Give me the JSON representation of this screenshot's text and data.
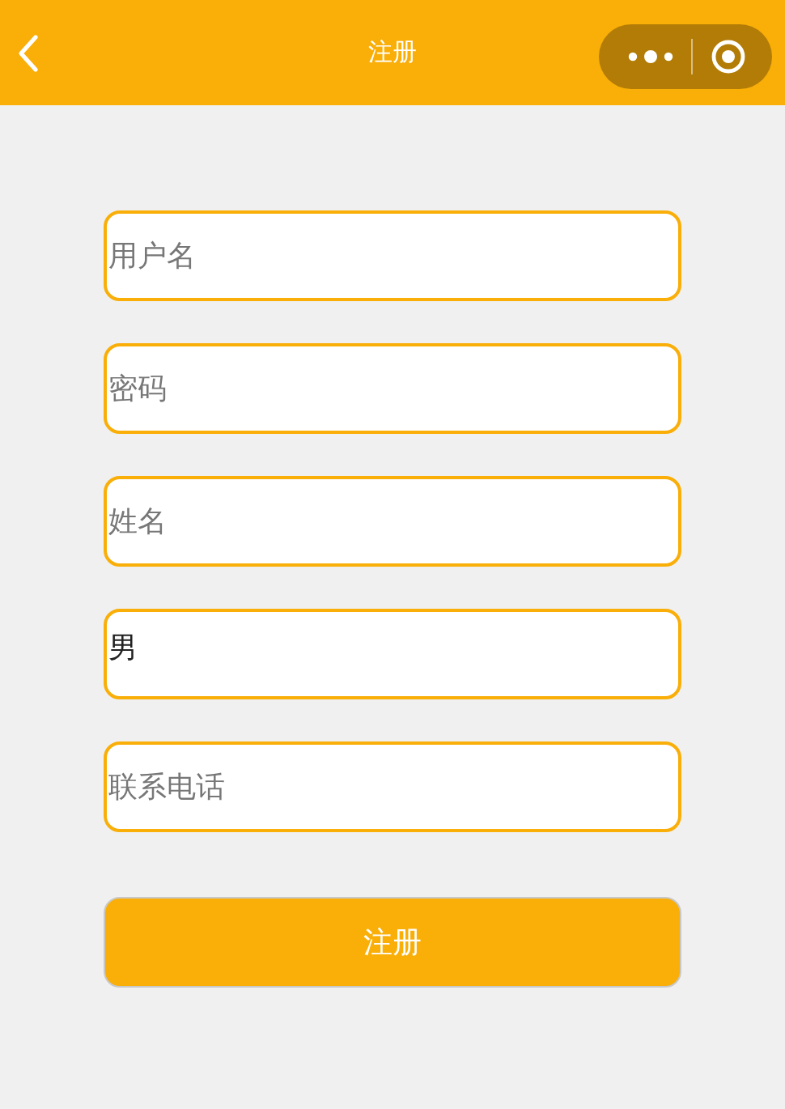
{
  "header": {
    "title": "注册"
  },
  "fields": [
    {
      "placeholder": "用户名"
    },
    {
      "placeholder": "密码"
    },
    {
      "placeholder": "姓名"
    },
    {
      "value": "男"
    },
    {
      "placeholder": "联系电话"
    }
  ],
  "submit_button": "注册"
}
